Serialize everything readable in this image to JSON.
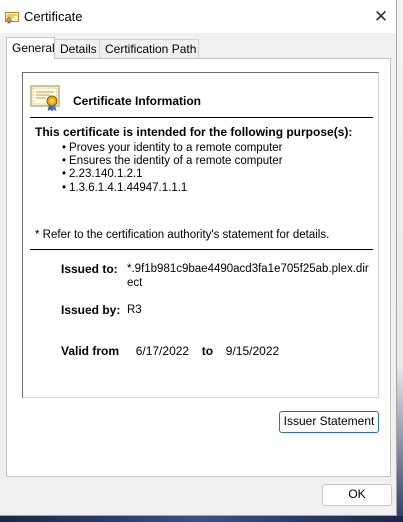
{
  "window": {
    "title": "Certificate",
    "close_glyph": "✕"
  },
  "tabs": [
    {
      "label": "General",
      "active": true
    },
    {
      "label": "Details",
      "active": false
    },
    {
      "label": "Certification Path",
      "active": false
    }
  ],
  "certificate": {
    "info_title": "Certificate Information",
    "purpose_heading": "This certificate is intended for the following purpose(s):",
    "purposes": [
      "Proves your identity to a remote computer",
      "Ensures the identity of a remote computer",
      "2.23.140.1.2.1",
      "1.3.6.1.4.1.44947.1.1.1"
    ],
    "refer_note": "* Refer to the certification authority's statement for details.",
    "issued_to_label": "Issued to:",
    "issued_to_value": "*.9f1b981c9bae4490acd3fa1e705f25ab.plex.direct",
    "issued_by_label": "Issued by:",
    "issued_by_value": "R3",
    "valid_from_label": "Valid from",
    "valid_from": "6/17/2022",
    "valid_to_label": "to",
    "valid_to": "9/15/2022"
  },
  "buttons": {
    "issuer_statement": "Issuer Statement",
    "ok": "OK"
  },
  "icons": {
    "title": "certificate-icon",
    "cert": "certificate-ribbon-icon",
    "close": "close-icon"
  },
  "colors": {
    "accent_border": "#2f6fb5",
    "panel_bg": "#ffffff",
    "window_bg": "#f0f0f0"
  }
}
